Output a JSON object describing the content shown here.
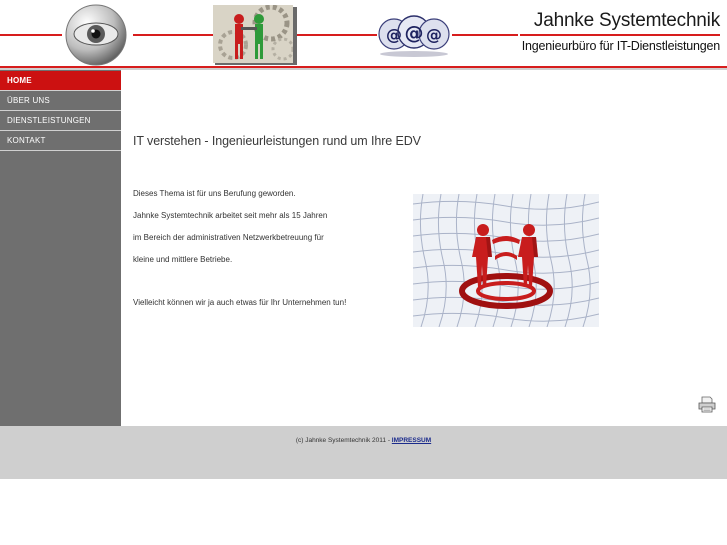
{
  "header": {
    "brand_title": "Jahnke Systemtechnik",
    "brand_subtitle": "Ingenieurbüro für IT-Dienstleistungen",
    "logos": [
      "eye-icon",
      "team-gears-icon",
      "email-at-icon"
    ]
  },
  "nav": {
    "items": [
      {
        "label": "HOME",
        "active": true
      },
      {
        "label": "ÜBER UNS",
        "active": false
      },
      {
        "label": "DIENSTLEISTUNGEN",
        "active": false
      },
      {
        "label": "KONTAKT",
        "active": false
      }
    ]
  },
  "main": {
    "headline": "IT verstehen - Ingenieurleistungen rund um Ihre EDV",
    "paragraphs": [
      "Dieses Thema ist für uns Berufung geworden.",
      "Jahnke Systemtechnik arbeitet seit mehr als 15 Jahren",
      "im Bereich der administrativen Netzwerkbetreuung für",
      "kleine und mittlere Betriebe.",
      "Vielleicht können wir ja auch etwas für Ihr Unternehmen tun!"
    ],
    "print_icon": "printer-icon"
  },
  "footer": {
    "copyright": "(c) Jahnke Systemtechnik 2011 -",
    "impressum": "IMPRESSUM"
  },
  "colors": {
    "accent_red": "#cc1111",
    "sidebar_grey": "#6f6f6f",
    "footer_grey": "#cfcfcf"
  }
}
